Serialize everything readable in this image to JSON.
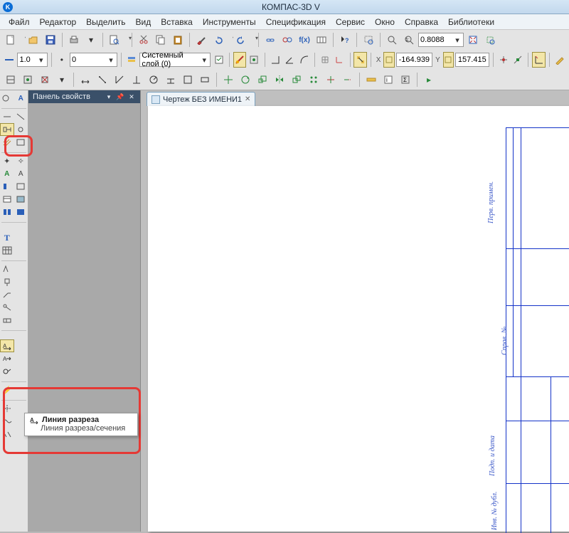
{
  "app": {
    "title": "КОМПАС-3D V",
    "icon_letter": "K"
  },
  "menu": {
    "items": [
      {
        "label": "Файл",
        "hot": "Ф"
      },
      {
        "label": "Редактор",
        "hot": "Р"
      },
      {
        "label": "Выделить",
        "hot": "В"
      },
      {
        "label": "Вид",
        "hot": "и"
      },
      {
        "label": "Вставка",
        "hot": "т"
      },
      {
        "label": "Инструменты",
        "hot": "И"
      },
      {
        "label": "Спецификация",
        "hot": "ц"
      },
      {
        "label": "Сервис",
        "hot": "р"
      },
      {
        "label": "Окно",
        "hot": "О"
      },
      {
        "label": "Справка",
        "hot": "С"
      },
      {
        "label": "Библиотеки",
        "hot": "Б"
      }
    ]
  },
  "toolbars": {
    "row1": {
      "zoom_field": "0.8088",
      "icons": {
        "new": "new-doc-icon",
        "open": "open-icon",
        "save": "save-icon",
        "print": "print-icon",
        "preview": "zoom-doc-icon",
        "cut": "cut-icon",
        "copy": "copy-icon",
        "paste": "paste-icon",
        "brush": "brush-icon",
        "undo": "undo-icon",
        "redo": "redo-icon",
        "link": "link-icon",
        "fx": "fx-icon",
        "vars": "vars-icon",
        "help": "help-arrow-icon",
        "zoom_window": "zoom-window-icon",
        "zoom1": "zoom-1-icon",
        "zoom_ext": "zoom-extents-icon",
        "pan": "pan-icon",
        "refresh": "refresh-icon",
        "redraw": "redraw-icon"
      }
    },
    "row2": {
      "line_width": "1.0",
      "field_b": "0",
      "layer_combo": "Системный слой (0)",
      "x_value": "-164.939",
      "y_value": "157.415"
    },
    "row3": {}
  },
  "prop_panel": {
    "title": "Панель свойств"
  },
  "document": {
    "tab_label": "Чертеж БЕЗ ИМЕНИ1",
    "frame_labels": {
      "a": "Перв. примен.",
      "b": "Справ. №",
      "c": "Подп. и дата",
      "d": "Инв. № дубл."
    }
  },
  "tooltip": {
    "title": "Линия разреза",
    "body": "Линия разреза/сечения"
  },
  "left_toolbar": {
    "active_tool": "section-line-button"
  }
}
